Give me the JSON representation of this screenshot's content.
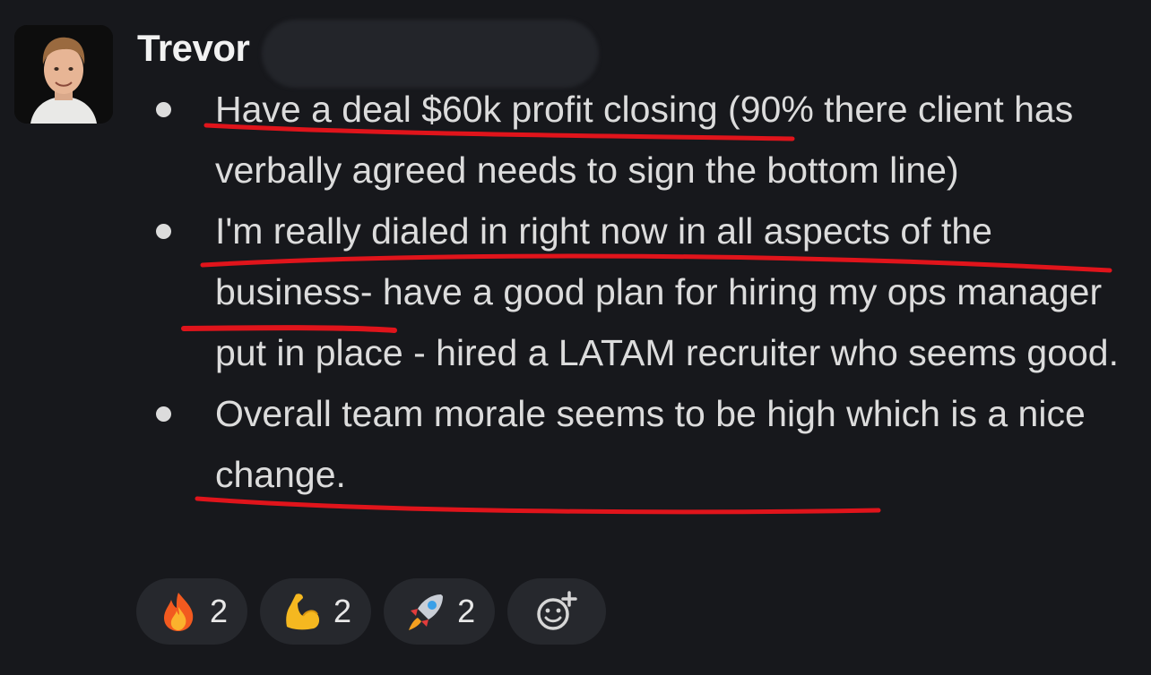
{
  "message": {
    "author": "Trevor",
    "bullets": [
      {
        "text": "Have a deal $60k profit closing (90% there client has verbally agreed needs to sign the bottom line)"
      },
      {
        "text": "I'm really dialed in right now  in all aspects of the business- have a good plan for hiring my ops manager put in place - hired a LATAM recruiter who seems good."
      },
      {
        "text": "Overall team morale seems to be high which is a nice change."
      }
    ]
  },
  "reactions": [
    {
      "icon": "fire-icon",
      "count": "2"
    },
    {
      "icon": "flexed-biceps-icon",
      "count": "2"
    },
    {
      "icon": "rocket-icon",
      "count": "2"
    }
  ],
  "colors": {
    "background": "#17181c",
    "text": "#dcdcdc",
    "pill": "#26282d",
    "underline": "#e0141b"
  }
}
